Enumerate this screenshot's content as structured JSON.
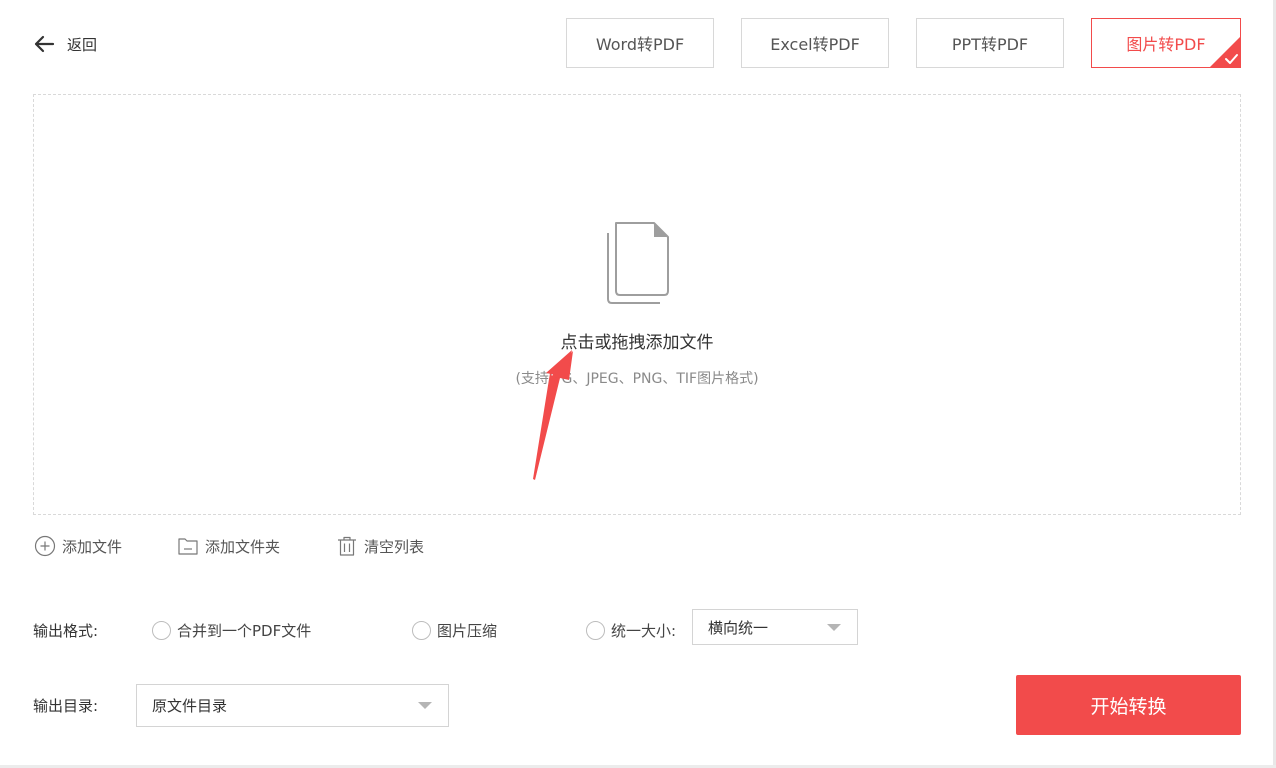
{
  "header": {
    "back_label": "返回",
    "tabs": [
      {
        "label": "Word转PDF",
        "active": false
      },
      {
        "label": "Excel转PDF",
        "active": false
      },
      {
        "label": "PPT转PDF",
        "active": false
      },
      {
        "label": "图片转PDF",
        "active": true
      }
    ]
  },
  "dropzone": {
    "icon": "document-stack-icon",
    "title": "点击或拖拽添加文件",
    "subtitle": "(支持JPG、JPEG、PNG、TIF图片格式)"
  },
  "file_actions": {
    "add_file": "添加文件",
    "add_folder": "添加文件夹",
    "clear_list": "清空列表"
  },
  "output_format": {
    "label": "输出格式:",
    "options": [
      "合并到一个PDF文件",
      "图片压缩",
      "统一大小:"
    ],
    "size_select": {
      "value": "横向统一"
    }
  },
  "output_dir": {
    "label": "输出目录:",
    "select": {
      "value": "原文件目录"
    }
  },
  "start_button": "开始转换",
  "colors": {
    "accent": "#f24b4b",
    "border": "#d8d8d8",
    "text": "#333333",
    "muted": "#8a8a8a"
  }
}
